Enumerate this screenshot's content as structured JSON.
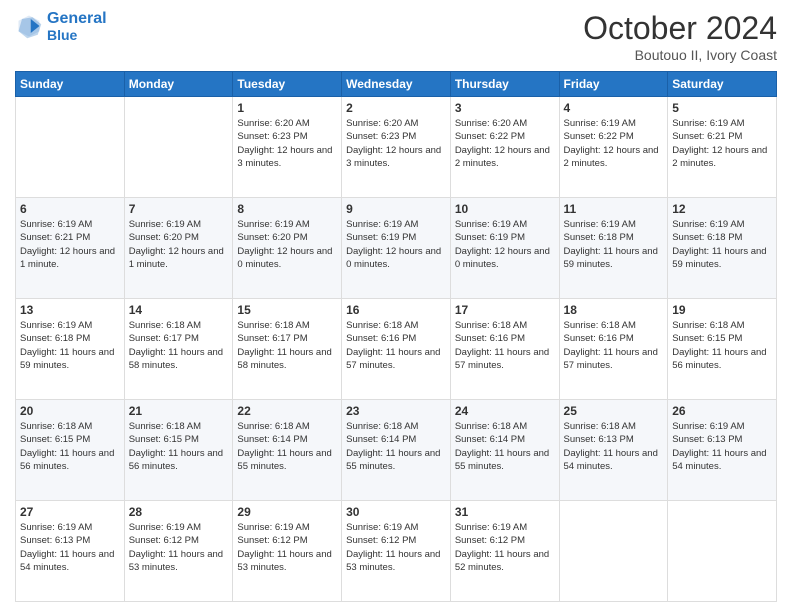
{
  "header": {
    "logo_line1": "General",
    "logo_line2": "Blue",
    "month_title": "October 2024",
    "subtitle": "Boutouo II, Ivory Coast"
  },
  "weekdays": [
    "Sunday",
    "Monday",
    "Tuesday",
    "Wednesday",
    "Thursday",
    "Friday",
    "Saturday"
  ],
  "weeks": [
    [
      {
        "day": "",
        "info": ""
      },
      {
        "day": "",
        "info": ""
      },
      {
        "day": "1",
        "info": "Sunrise: 6:20 AM\nSunset: 6:23 PM\nDaylight: 12 hours and 3 minutes."
      },
      {
        "day": "2",
        "info": "Sunrise: 6:20 AM\nSunset: 6:23 PM\nDaylight: 12 hours and 3 minutes."
      },
      {
        "day": "3",
        "info": "Sunrise: 6:20 AM\nSunset: 6:22 PM\nDaylight: 12 hours and 2 minutes."
      },
      {
        "day": "4",
        "info": "Sunrise: 6:19 AM\nSunset: 6:22 PM\nDaylight: 12 hours and 2 minutes."
      },
      {
        "day": "5",
        "info": "Sunrise: 6:19 AM\nSunset: 6:21 PM\nDaylight: 12 hours and 2 minutes."
      }
    ],
    [
      {
        "day": "6",
        "info": "Sunrise: 6:19 AM\nSunset: 6:21 PM\nDaylight: 12 hours and 1 minute."
      },
      {
        "day": "7",
        "info": "Sunrise: 6:19 AM\nSunset: 6:20 PM\nDaylight: 12 hours and 1 minute."
      },
      {
        "day": "8",
        "info": "Sunrise: 6:19 AM\nSunset: 6:20 PM\nDaylight: 12 hours and 0 minutes."
      },
      {
        "day": "9",
        "info": "Sunrise: 6:19 AM\nSunset: 6:19 PM\nDaylight: 12 hours and 0 minutes."
      },
      {
        "day": "10",
        "info": "Sunrise: 6:19 AM\nSunset: 6:19 PM\nDaylight: 12 hours and 0 minutes."
      },
      {
        "day": "11",
        "info": "Sunrise: 6:19 AM\nSunset: 6:18 PM\nDaylight: 11 hours and 59 minutes."
      },
      {
        "day": "12",
        "info": "Sunrise: 6:19 AM\nSunset: 6:18 PM\nDaylight: 11 hours and 59 minutes."
      }
    ],
    [
      {
        "day": "13",
        "info": "Sunrise: 6:19 AM\nSunset: 6:18 PM\nDaylight: 11 hours and 59 minutes."
      },
      {
        "day": "14",
        "info": "Sunrise: 6:18 AM\nSunset: 6:17 PM\nDaylight: 11 hours and 58 minutes."
      },
      {
        "day": "15",
        "info": "Sunrise: 6:18 AM\nSunset: 6:17 PM\nDaylight: 11 hours and 58 minutes."
      },
      {
        "day": "16",
        "info": "Sunrise: 6:18 AM\nSunset: 6:16 PM\nDaylight: 11 hours and 57 minutes."
      },
      {
        "day": "17",
        "info": "Sunrise: 6:18 AM\nSunset: 6:16 PM\nDaylight: 11 hours and 57 minutes."
      },
      {
        "day": "18",
        "info": "Sunrise: 6:18 AM\nSunset: 6:16 PM\nDaylight: 11 hours and 57 minutes."
      },
      {
        "day": "19",
        "info": "Sunrise: 6:18 AM\nSunset: 6:15 PM\nDaylight: 11 hours and 56 minutes."
      }
    ],
    [
      {
        "day": "20",
        "info": "Sunrise: 6:18 AM\nSunset: 6:15 PM\nDaylight: 11 hours and 56 minutes."
      },
      {
        "day": "21",
        "info": "Sunrise: 6:18 AM\nSunset: 6:15 PM\nDaylight: 11 hours and 56 minutes."
      },
      {
        "day": "22",
        "info": "Sunrise: 6:18 AM\nSunset: 6:14 PM\nDaylight: 11 hours and 55 minutes."
      },
      {
        "day": "23",
        "info": "Sunrise: 6:18 AM\nSunset: 6:14 PM\nDaylight: 11 hours and 55 minutes."
      },
      {
        "day": "24",
        "info": "Sunrise: 6:18 AM\nSunset: 6:14 PM\nDaylight: 11 hours and 55 minutes."
      },
      {
        "day": "25",
        "info": "Sunrise: 6:18 AM\nSunset: 6:13 PM\nDaylight: 11 hours and 54 minutes."
      },
      {
        "day": "26",
        "info": "Sunrise: 6:19 AM\nSunset: 6:13 PM\nDaylight: 11 hours and 54 minutes."
      }
    ],
    [
      {
        "day": "27",
        "info": "Sunrise: 6:19 AM\nSunset: 6:13 PM\nDaylight: 11 hours and 54 minutes."
      },
      {
        "day": "28",
        "info": "Sunrise: 6:19 AM\nSunset: 6:12 PM\nDaylight: 11 hours and 53 minutes."
      },
      {
        "day": "29",
        "info": "Sunrise: 6:19 AM\nSunset: 6:12 PM\nDaylight: 11 hours and 53 minutes."
      },
      {
        "day": "30",
        "info": "Sunrise: 6:19 AM\nSunset: 6:12 PM\nDaylight: 11 hours and 53 minutes."
      },
      {
        "day": "31",
        "info": "Sunrise: 6:19 AM\nSunset: 6:12 PM\nDaylight: 11 hours and 52 minutes."
      },
      {
        "day": "",
        "info": ""
      },
      {
        "day": "",
        "info": ""
      }
    ]
  ]
}
